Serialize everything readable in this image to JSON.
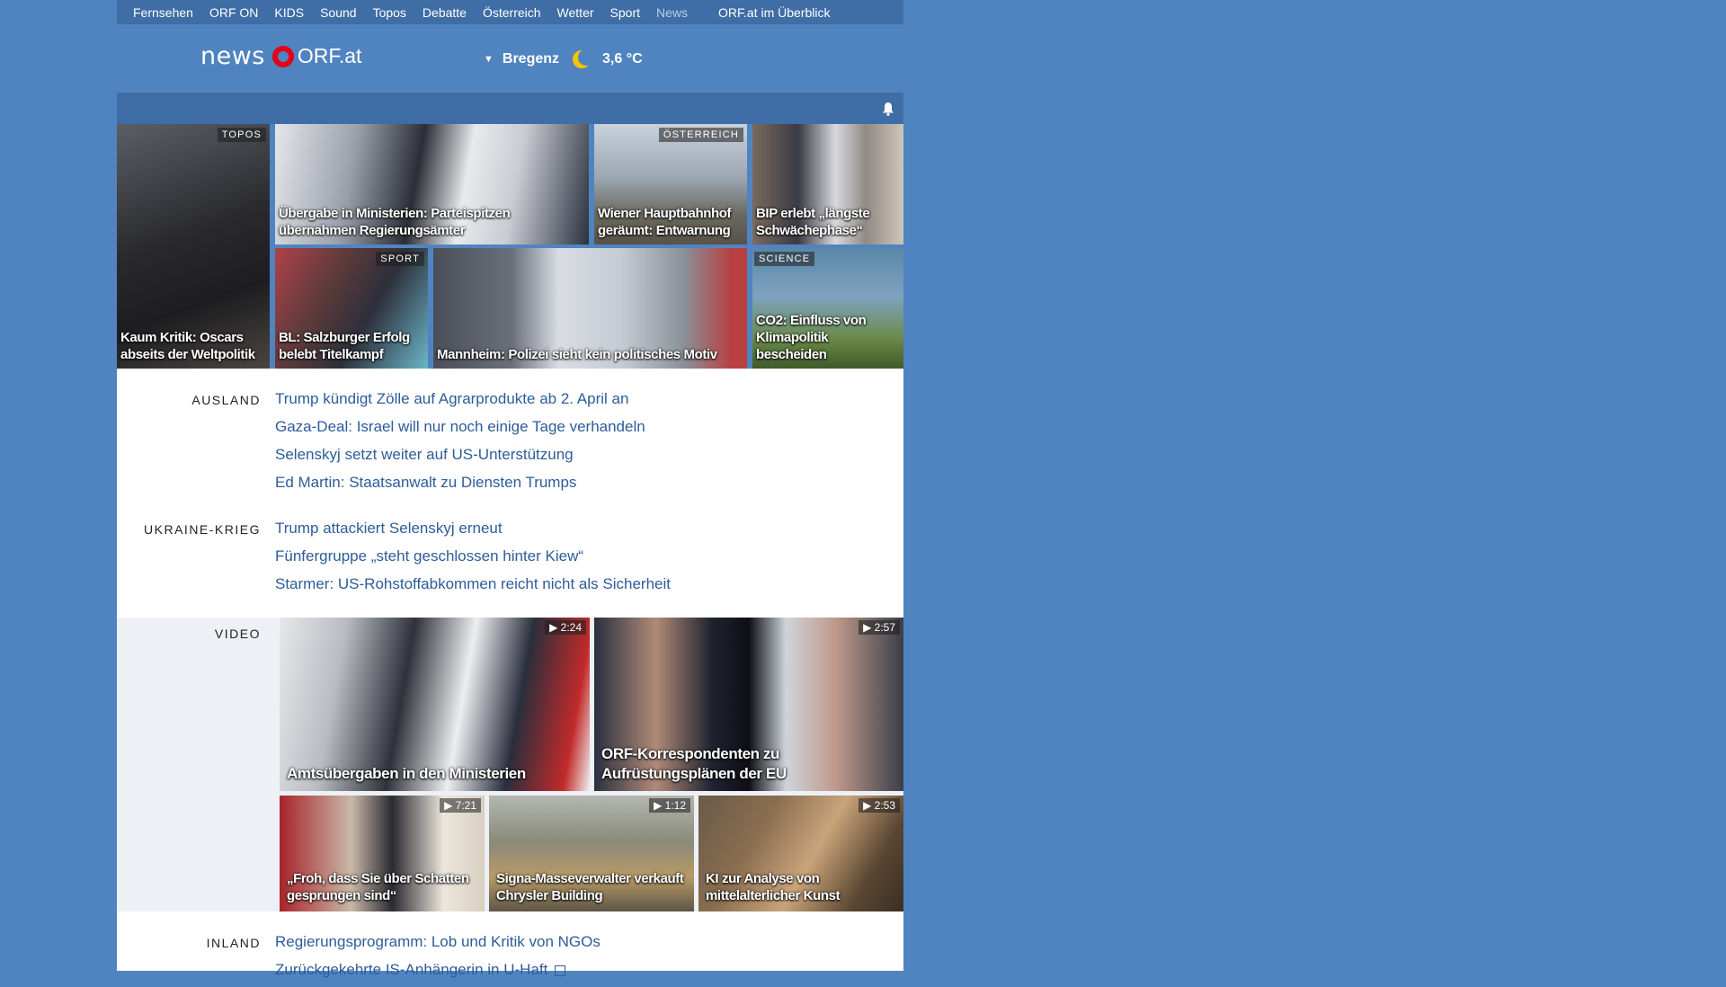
{
  "topnav": {
    "items": [
      "Fernsehen",
      "ORF ON",
      "KIDS",
      "Sound",
      "Topos",
      "Debatte",
      "Österreich",
      "Wetter",
      "Sport",
      "News"
    ],
    "current": "News",
    "overview": "ORF.at im Überblick"
  },
  "header": {
    "logo_news": "news",
    "logo_orf": "ORF.at",
    "location": "Bregenz",
    "temperature": "3,6 °C"
  },
  "tiles": [
    {
      "tag": "TOPOS",
      "caption": "Kaum Kritik: Oscars abseits der Weltpolitik"
    },
    {
      "tag": "",
      "caption": "Übergabe in Ministerien: Parteispitzen übernahmen Regierungsämter"
    },
    {
      "tag": "ÖSTERREICH",
      "caption": "Wiener Hauptbahnhof geräumt: Entwarnung"
    },
    {
      "tag": "",
      "caption": "BIP erlebt „längste Schwächephase“"
    },
    {
      "tag": "SPORT",
      "caption": "BL: Salzburger Erfolg belebt Titelkampf"
    },
    {
      "tag": "",
      "caption": "Mannheim: Polizei sieht kein politisches Motiv"
    },
    {
      "tag": "SCIENCE",
      "caption": "CO2: Einfluss von Klimapolitik bescheiden"
    }
  ],
  "sections": {
    "ausland": {
      "label": "AUSLAND",
      "links": [
        "Trump kündigt Zölle auf Agrarprodukte ab 2. April an",
        "Gaza-Deal: Israel will nur noch einige Tage verhandeln",
        "Selenskyj setzt weiter auf US-Unterstützung",
        "Ed Martin: Staatsanwalt zu Diensten Trumps"
      ]
    },
    "ukraine": {
      "label": "UKRAINE-KRIEG",
      "links": [
        "Trump attackiert Selenskyj erneut",
        "Fünfergruppe „steht geschlossen hinter Kiew“",
        "Starmer: US-Rohstoffabkommen reicht nicht als Sicherheit"
      ]
    },
    "video": {
      "label": "VIDEO",
      "items": [
        {
          "duration": "2:24",
          "caption": "Amtsübergaben in den Ministerien"
        },
        {
          "duration": "2:57",
          "caption": "ORF-Korrespondenten zu Aufrüstungsplänen der EU"
        },
        {
          "duration": "7:21",
          "caption": "„Froh, dass Sie über Schatten gesprungen sind“"
        },
        {
          "duration": "1:12",
          "caption": "Signa-Masseverwalter verkauft Chrysler Building"
        },
        {
          "duration": "2:53",
          "caption": "KI zur Analyse von mittelalterlicher Kunst"
        }
      ]
    },
    "inland": {
      "label": "INLAND",
      "links": [
        "Regierungsprogramm: Lob und Kritik von NGOs",
        "Zurückgekehrte IS-Anhängerin in U-Haft"
      ]
    }
  },
  "colors": {
    "background": "#5084c0",
    "nav": "#3f6da5",
    "link": "#2d5c9a",
    "orf_red": "#e2001a"
  },
  "icons": [
    "bell-icon",
    "moon-icon",
    "play-icon",
    "external-link-icon",
    "dropdown-triangle-icon"
  ]
}
